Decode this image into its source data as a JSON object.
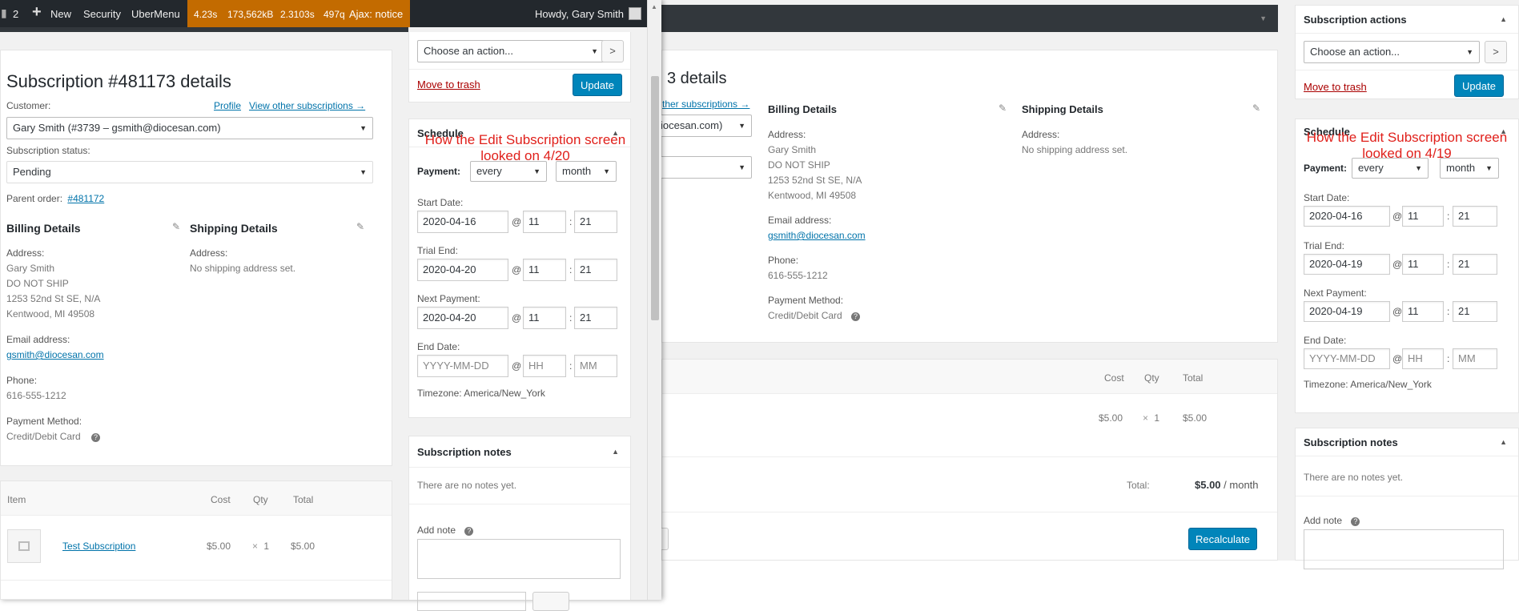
{
  "adminbar": {
    "comments_count": "2",
    "new_label": "New",
    "security_label": "Security",
    "ubermenu_label": "UberMenu",
    "qm_time": "4.23s",
    "qm_memory": "173,562kB",
    "qm_db_time": "2.3103s",
    "qm_queries": "497q",
    "qm_ajax": "Ajax: notice",
    "howdy": "Howdy, Gary Smith"
  },
  "front": {
    "title": "Subscription #481173 details",
    "customer_label": "Customer:",
    "profile_link": "Profile",
    "other_subs_link": "View other subscriptions →",
    "customer_value": "Gary Smith (#3739 – gsmith@diocesan.com)",
    "status_label": "Subscription status:",
    "status_value": "Pending",
    "parent_label": "Parent order:",
    "parent_link": "#481172",
    "billing_header": "Billing Details",
    "shipping_header": "Shipping Details",
    "address_label": "Address:",
    "address_lines": [
      "Gary Smith",
      "DO NOT SHIP",
      "1253 52nd St SE, N/A",
      "Kentwood, MI 49508"
    ],
    "shipping_address_label": "Address:",
    "shipping_address_value": "No shipping address set.",
    "email_label": "Email address:",
    "email_value": "gsmith@diocesan.com",
    "phone_label": "Phone:",
    "phone_value": "616-555-1212",
    "payment_method_label": "Payment Method:",
    "payment_method_value": "Credit/Debit Card",
    "items": {
      "headers": {
        "item": "Item",
        "cost": "Cost",
        "qty": "Qty",
        "total": "Total"
      },
      "row": {
        "name": "Test Subscription",
        "cost": "$5.00",
        "qty_sign": "×",
        "qty": "1",
        "total": "$5.00"
      }
    },
    "actions": {
      "select_value": "Choose an action...",
      "go": ">",
      "trash": "Move to trash",
      "update": "Update"
    },
    "schedule": {
      "header": "Schedule",
      "payment_label": "Payment:",
      "interval": "every",
      "period": "month",
      "start_label": "Start Date:",
      "start_date": "2020-04-16",
      "start_h": "11",
      "start_m": "21",
      "trial_label": "Trial End:",
      "trial_date": "2020-04-20",
      "trial_h": "11",
      "trial_m": "21",
      "next_label": "Next Payment:",
      "next_date": "2020-04-20",
      "next_h": "11",
      "next_m": "21",
      "end_label": "End Date:",
      "end_date_ph": "YYYY-MM-DD",
      "end_h_ph": "HH",
      "end_m_ph": "MM",
      "at": "@",
      "colon": ":",
      "timezone": "Timezone: America/New_York"
    },
    "notes": {
      "header": "Subscription notes",
      "empty": "There are no notes yet.",
      "add_label": "Add note"
    },
    "annotation": "How the Edit Subscription screen looked on 4/20"
  },
  "back": {
    "title_partial": "3 details",
    "other_subs_partial": "ther subscriptions →",
    "customer_partial": "iocesan.com)",
    "billing_header": "Billing Details",
    "shipping_header": "Shipping Details",
    "address_label": "Address:",
    "address_lines": [
      "Gary Smith",
      "DO NOT SHIP",
      "1253 52nd St SE, N/A",
      "Kentwood, MI 49508"
    ],
    "shipping_address_label": "Address:",
    "shipping_address_value": "No shipping address set.",
    "email_label": "Email address:",
    "email_value": "gsmith@diocesan.com",
    "phone_label": "Phone:",
    "phone_value": "616-555-1212",
    "payment_method_label": "Payment Method:",
    "payment_method_value": "Credit/Debit Card",
    "items": {
      "headers": {
        "cost": "Cost",
        "qty": "Qty",
        "total": "Total"
      },
      "row": {
        "cost": "$5.00",
        "qty_sign": "×",
        "qty": "1",
        "total": "$5.00"
      }
    },
    "totals": {
      "label": "Total:",
      "value": "$5.00",
      "suffix": "/ month"
    },
    "recalculate": "Recalculate",
    "actions": {
      "header": "Subscription actions",
      "select_value": "Choose an action...",
      "go": ">",
      "trash": "Move to trash",
      "update": "Update"
    },
    "schedule": {
      "header": "Schedule",
      "payment_label": "Payment:",
      "interval": "every",
      "period": "month",
      "start_label": "Start Date:",
      "start_date": "2020-04-16",
      "start_h": "11",
      "start_m": "21",
      "trial_label": "Trial End:",
      "trial_date": "2020-04-19",
      "trial_h": "11",
      "trial_m": "21",
      "next_label": "Next Payment:",
      "next_date": "2020-04-19",
      "next_h": "11",
      "next_m": "21",
      "end_label": "End Date:",
      "end_date_ph": "YYYY-MM-DD",
      "end_h_ph": "HH",
      "end_m_ph": "MM",
      "at": "@",
      "colon": ":",
      "timezone": "Timezone: America/New_York"
    },
    "notes": {
      "header": "Subscription notes",
      "empty": "There are no notes yet.",
      "add_label": "Add note"
    },
    "annotation": "How the Edit Subscription screen looked on 4/19"
  },
  "colors": {
    "adminbar_bg": "#23282d",
    "qm_bg": "#c36b00",
    "primary_button": "#0085ba",
    "annotation_red": "#e0201b",
    "trash_red": "#a00",
    "link_blue": "#0073aa"
  }
}
